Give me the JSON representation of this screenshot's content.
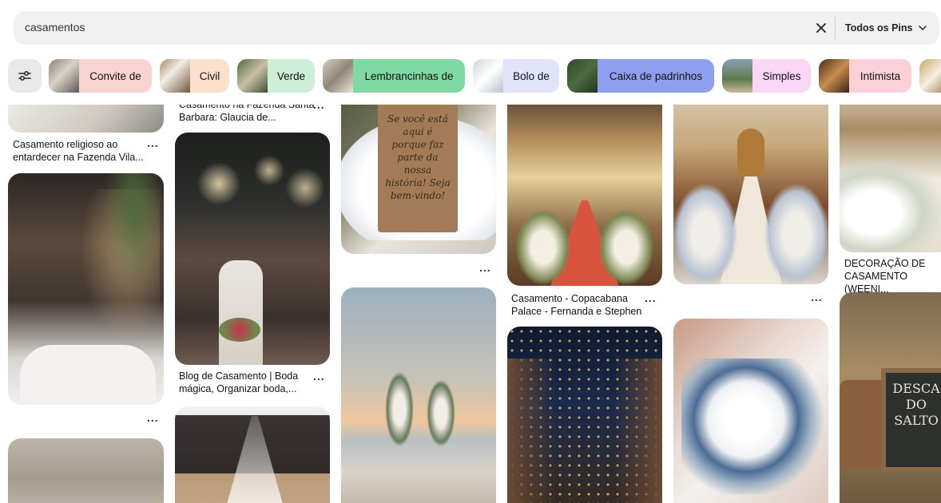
{
  "search": {
    "query": "casamentos",
    "pins_filter": "Todos os Pins"
  },
  "chips": [
    {
      "label": "Convite de",
      "bg": "#f9d3cf"
    },
    {
      "label": "Civil",
      "bg": "#fbe0cc"
    },
    {
      "label": "Verde",
      "bg": "#cdeed7"
    },
    {
      "label": "Lembrancinhas de",
      "bg": "#7ed9a3"
    },
    {
      "label": "Bolo de",
      "bg": "#dfe4fb"
    },
    {
      "label": "Caixa de padrinhos",
      "bg": "#8f9ff0"
    },
    {
      "label": "Simples",
      "bg": "#fbd7f5"
    },
    {
      "label": "Intimista",
      "bg": "#fbd0d6"
    }
  ],
  "pins": {
    "p1_caption": "Casamento religioso ao entardecer na Fazenda Vila...",
    "p2_caption": "Casamento na Fazenda Santa Barbara: Glaucia de...",
    "p3_caption": "Blog de Casamento | Boda mágica, Organizar boda,...",
    "p4_caption": "Casamento - Copacabana Palace - Fernanda e Stephen",
    "p5_caption": "DECORAÇÃO DE CASAMENTO (WEENI...",
    "more": "...",
    "card_sign_text": "Se você está aqui é porque faz parte da nossa história! Seja bem-vindo!",
    "chalk_sign_text": "DESCA DO SALTO"
  },
  "colors": {
    "search_bg": "#f1f1f1",
    "filter_bg": "#e9e9e9"
  }
}
